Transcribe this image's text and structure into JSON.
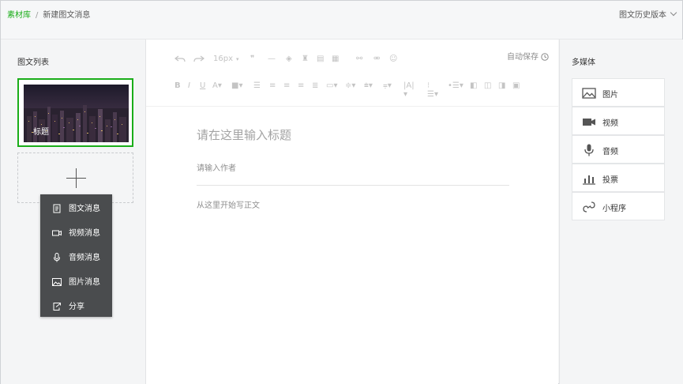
{
  "breadcrumb": {
    "home": "素材库",
    "separator": "/",
    "current": "新建图文消息"
  },
  "history_label": "图文历史版本",
  "left_panel": {
    "title": "图文列表",
    "cover_title": "标题",
    "add_icon": "plus-icon"
  },
  "add_menu": [
    {
      "label": "图文消息",
      "icon": "article-icon"
    },
    {
      "label": "视频消息",
      "icon": "video-icon"
    },
    {
      "label": "音频消息",
      "icon": "microphone-icon"
    },
    {
      "label": "图片消息",
      "icon": "image-icon"
    },
    {
      "label": "分享",
      "icon": "share-icon"
    }
  ],
  "editor": {
    "autosave": "自动保存",
    "font_size": "16px",
    "title_placeholder": "请在这里输入标题",
    "author_placeholder": "请输入作者",
    "body_placeholder": "从这里开始写正文"
  },
  "media_panel": {
    "title": "多媒体",
    "items": [
      {
        "label": "图片",
        "icon": "image-icon"
      },
      {
        "label": "视频",
        "icon": "video-icon"
      },
      {
        "label": "音频",
        "icon": "microphone-icon"
      },
      {
        "label": "投票",
        "icon": "bar-chart-icon"
      },
      {
        "label": "小程序",
        "icon": "mini-program-icon"
      }
    ]
  },
  "colors": {
    "accent": "#1aad19",
    "menu_bg": "#4a4c4e"
  }
}
